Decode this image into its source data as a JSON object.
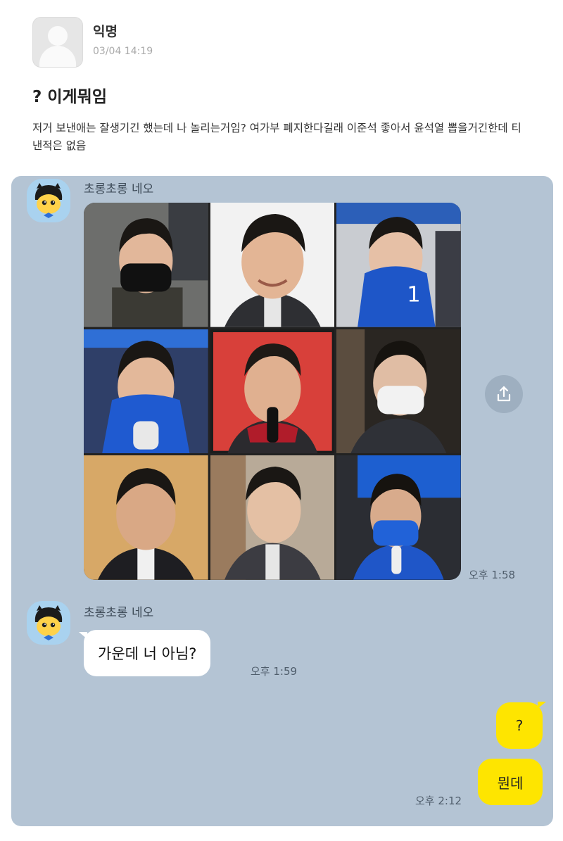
{
  "post": {
    "author": "익명",
    "timestamp": "03/04 14:19",
    "title": "? 이게뭐임",
    "body": "저거 보낸애는 잘생기긴 했는데 나 놀리는거임? 여가부 폐지한다길래 이준석 좋아서 윤석열 뽑을거긴한데 티낸적은 없음"
  },
  "chat": {
    "messages": [
      {
        "sender": "초롱초롱 네오",
        "type": "photo-grid",
        "time": "오후 1:58"
      },
      {
        "sender": "초롱초롱 네오",
        "type": "text",
        "text": "가운데 너 아님?",
        "time": "오후 1:59"
      },
      {
        "sender": "me",
        "type": "text",
        "text": "?"
      },
      {
        "sender": "me",
        "type": "text",
        "text": "뭔데",
        "time": "오후 2:12"
      }
    ]
  },
  "colors": {
    "chat_background": "#b4c4d4",
    "my_bubble": "#fee500",
    "their_bubble": "#ffffff"
  },
  "icons": {
    "share": "share-upload-icon",
    "anonymous_avatar": "anonymous-profile-icon",
    "sender_avatar": "neo-character-avatar"
  }
}
